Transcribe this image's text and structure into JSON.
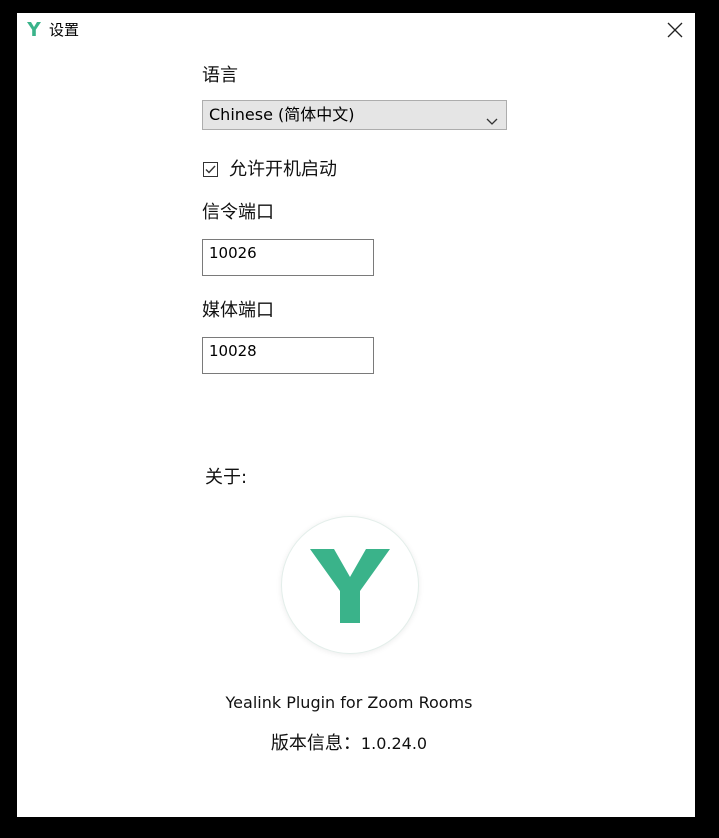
{
  "window": {
    "title": "设置"
  },
  "settings": {
    "language_label": "语言",
    "language_value": "Chinese (简体中文)",
    "autostart_label": "允许开机启动",
    "autostart_checked": true,
    "signal_port_label": "信令端口",
    "signal_port_value": "10026",
    "media_port_label": "媒体端口",
    "media_port_value": "10028"
  },
  "about": {
    "label": "关于:",
    "product_name": "Yealink Plugin for Zoom Rooms",
    "version_label": "版本信息：",
    "version_value": "1.0.24.0"
  },
  "icons": {
    "app_logo": "yealink-y-icon",
    "close": "close-icon",
    "dropdown": "chevron-down-icon",
    "checkbox": "checkbox-checked-icon"
  },
  "colors": {
    "brand_green": "#3ab38a",
    "window_bg": "#ffffff",
    "backdrop": "#000000"
  }
}
